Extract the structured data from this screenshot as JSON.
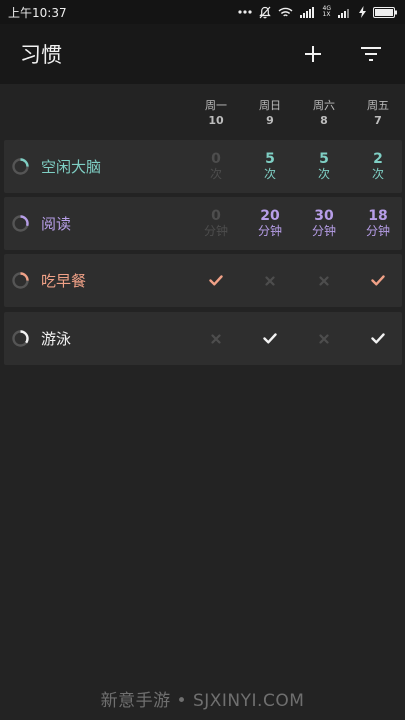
{
  "status_bar": {
    "time": "上午10:37",
    "network": "4G",
    "network_sub": "1X"
  },
  "app_bar": {
    "title": "习惯"
  },
  "days": [
    {
      "label": "周一",
      "num": "10"
    },
    {
      "label": "周日",
      "num": "9"
    },
    {
      "label": "周六",
      "num": "8"
    },
    {
      "label": "周五",
      "num": "7"
    }
  ],
  "colors": {
    "teal": "#7fcfc4",
    "purple": "#b79ee8",
    "orange": "#f0a187",
    "white": "#f2f2f2",
    "dim": "#4d4d4d",
    "bg": "#232323",
    "row": "#2e2e2e"
  },
  "habits": [
    {
      "name": "空闲大脑",
      "color": "#7fcfc4",
      "ring_progress": 0.25,
      "cells": [
        {
          "value": "0",
          "unit": "次"
        },
        {
          "value": "5",
          "unit": "次"
        },
        {
          "value": "5",
          "unit": "次"
        },
        {
          "value": "2",
          "unit": "次"
        }
      ]
    },
    {
      "name": "阅读",
      "color": "#b79ee8",
      "ring_progress": 0.3,
      "cells": [
        {
          "value": "0",
          "unit": "分钟"
        },
        {
          "value": "20",
          "unit": "分钟"
        },
        {
          "value": "30",
          "unit": "分钟"
        },
        {
          "value": "18",
          "unit": "分钟"
        }
      ]
    },
    {
      "name": "吃早餐",
      "color": "#f0a187",
      "ring_progress": 0.25,
      "cells": [
        {
          "done": true
        },
        {
          "done": false
        },
        {
          "done": false
        },
        {
          "done": true
        }
      ]
    },
    {
      "name": "游泳",
      "color": "#f2f2f2",
      "ring_progress": 0.35,
      "cells": [
        {
          "done": false
        },
        {
          "done": true
        },
        {
          "done": false
        },
        {
          "done": true
        }
      ]
    }
  ],
  "watermark": "新意手游 • SJXINYI.COM"
}
